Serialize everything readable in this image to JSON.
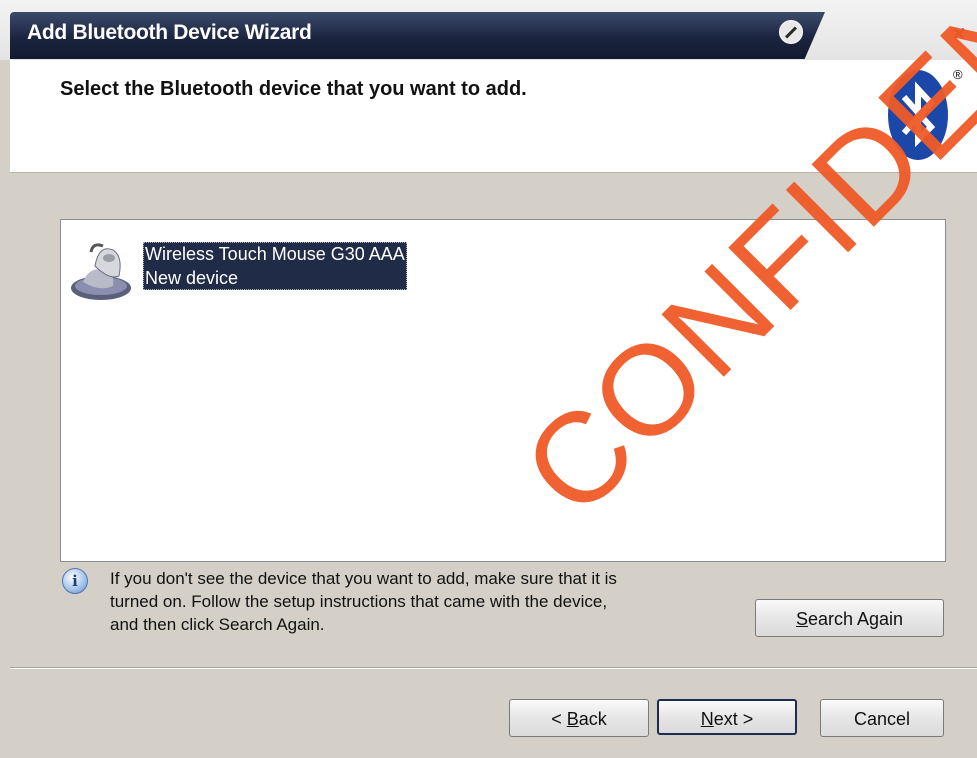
{
  "window": {
    "title": "Add Bluetooth Device Wizard",
    "close_label": "×"
  },
  "header": {
    "title": "Select the Bluetooth device that you want to add.",
    "logo_mark": "®"
  },
  "devices": [
    {
      "name": "Wireless Touch Mouse G30 AAA",
      "status": "New device",
      "icon": "mouse-icon",
      "selected": true
    }
  ],
  "info": {
    "icon_glyph": "i",
    "lines": [
      "If you don't see the device that you want to add, make sure that it is",
      "turned on. Follow the setup instructions that came with the device,",
      "and then click Search Again."
    ]
  },
  "buttons": {
    "search_again": {
      "mnemonic": "S",
      "rest": "earch Again"
    },
    "back": {
      "prefix": "< ",
      "mnemonic": "B",
      "rest": "ack"
    },
    "next": {
      "mnemonic": "N",
      "rest": "ext >"
    },
    "cancel": "Cancel"
  },
  "watermark": "CONFIDENTIAL",
  "colors": {
    "title_bar": "#1b2540",
    "selection": "#1f2b47",
    "watermark": "#f05a28",
    "bluetooth_blue": "#1a47a8"
  }
}
